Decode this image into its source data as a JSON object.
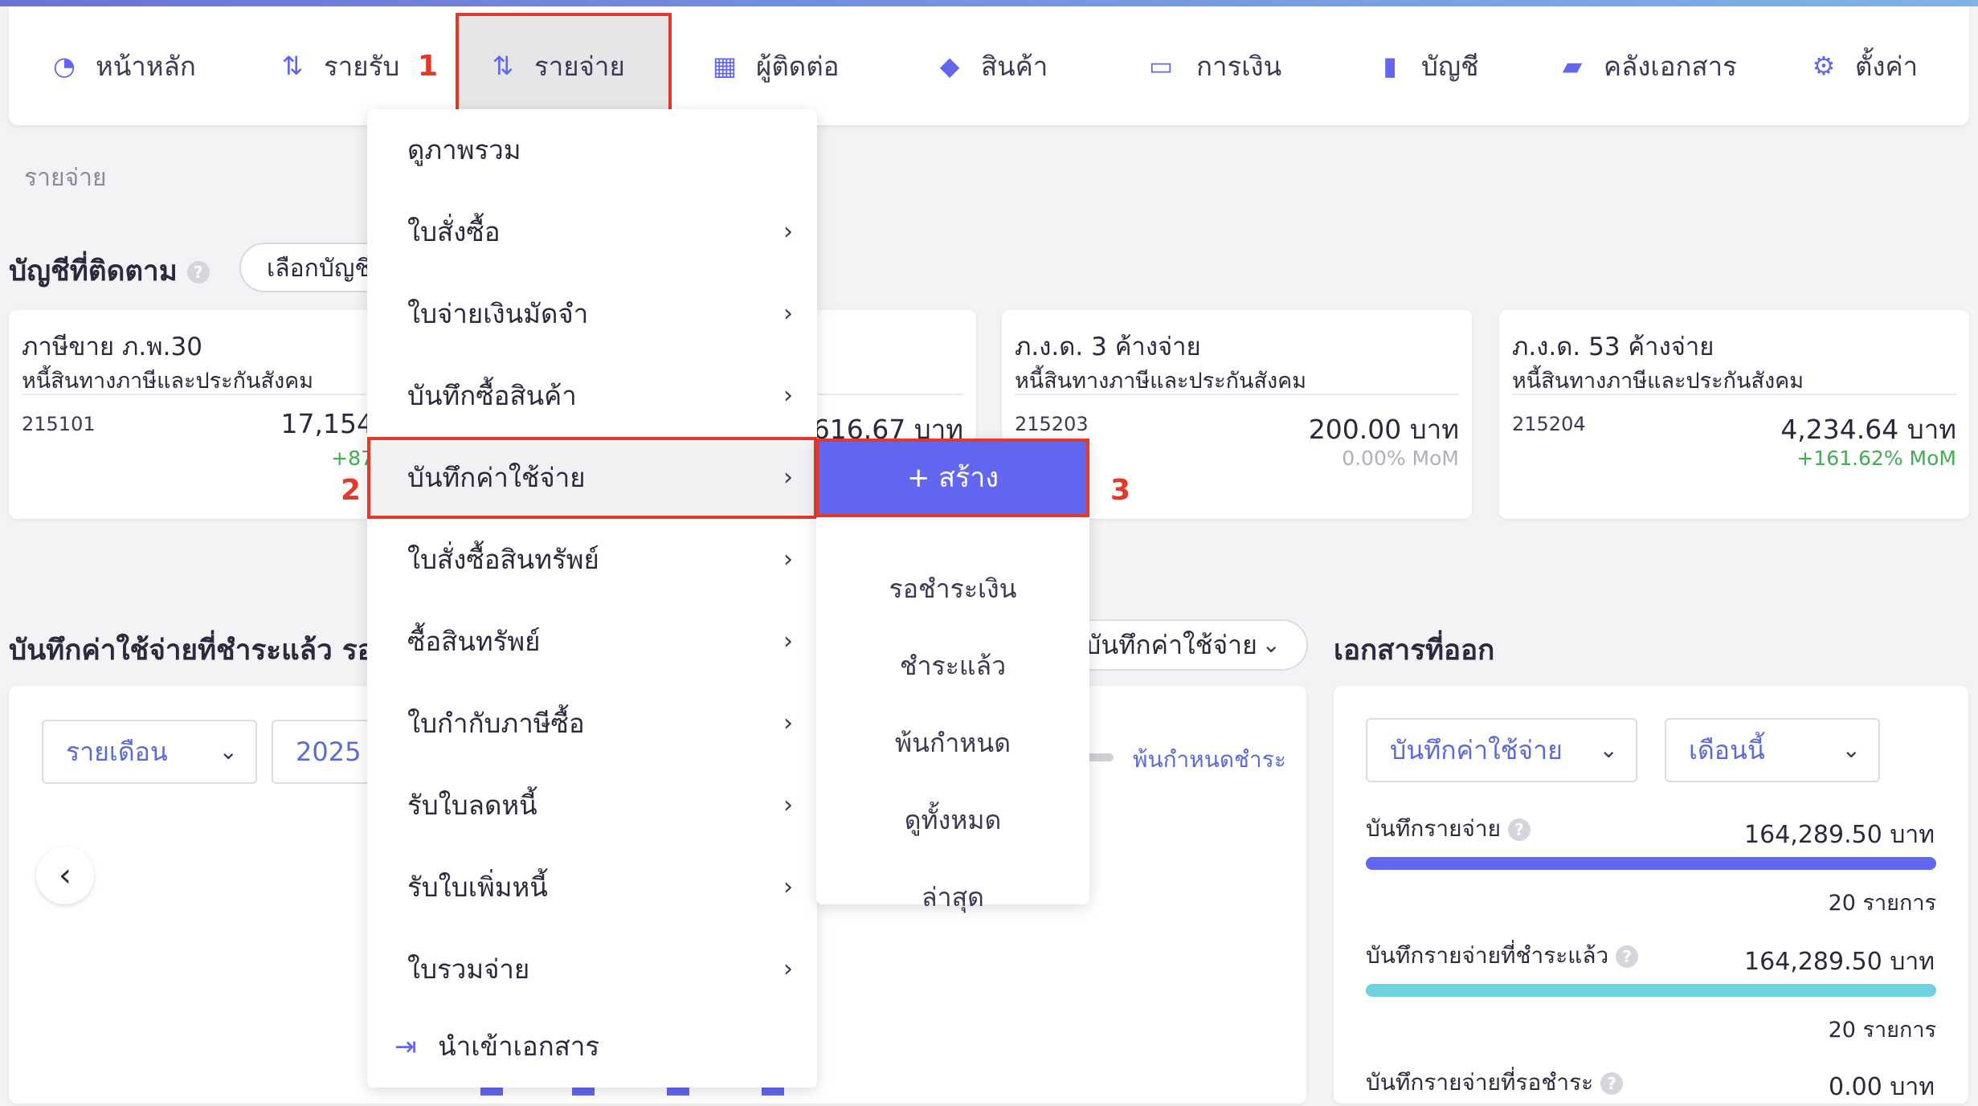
{
  "nav": {
    "items": [
      {
        "label": "หน้าหลัก",
        "icon": "chart-circle-icon"
      },
      {
        "label": "รายรับ",
        "icon": "sort-list-icon"
      },
      {
        "label": "รายจ่าย",
        "icon": "sort-list-icon"
      },
      {
        "label": "ผู้ติดต่อ",
        "icon": "building-icon"
      },
      {
        "label": "สินค้า",
        "icon": "box-icon"
      },
      {
        "label": "การเงิน",
        "icon": "money-icon"
      },
      {
        "label": "บัญชี",
        "icon": "book-icon"
      },
      {
        "label": "คลังเอกสาร",
        "icon": "folder-icon"
      },
      {
        "label": "ตั้งค่า",
        "icon": "gear-icon"
      }
    ]
  },
  "annotations": {
    "step1": "1",
    "step2": "2",
    "step3": "3"
  },
  "breadcrumb": "รายจ่าย",
  "tracked": {
    "title": "บัญชีที่ติดตาม",
    "select_label": "เลือกบัญชี",
    "cards": [
      {
        "title": "ภาษีขาย ภ.พ.30",
        "subtitle": "หนี้สินทางภาษีและประกันสังคม",
        "code": "215101",
        "amount": "17,154",
        "mom": "+87"
      },
      {
        "amount": "616.67 บาท"
      },
      {
        "title": "ภ.ง.ด. 3 ค้างจ่าย",
        "subtitle": "หนี้สินทางภาษีและประกันสังคม",
        "code": "215203",
        "amount": "200.00 บาท",
        "mom": "0.00% MoM"
      },
      {
        "title": "ภ.ง.ด. 53 ค้างจ่าย",
        "subtitle": "หนี้สินทางภาษีและประกันสังคม",
        "code": "215204",
        "amount": "4,234.64 บาท",
        "mom": "+161.62% MoM"
      }
    ]
  },
  "expense_section": {
    "title": "บันทึกค่าใช้จ่ายที่ชำระแล้ว รอชำ",
    "period_select": "รายเดือน",
    "year": "2025",
    "doc_type_select": "บันทึกค่าใช้จ่าย",
    "legend_overdue": "พ้นกำหนดชำระ"
  },
  "issued": {
    "title": "เอกสารที่ออก",
    "doc_select": "บันทึกค่าใช้จ่าย",
    "period_select": "เดือนนี้",
    "stats": [
      {
        "label": "บันทึกรายจ่าย",
        "value": "164,289.50 บาท",
        "count": "20 รายการ",
        "color": "#6366f1",
        "fill": 1.0
      },
      {
        "label": "บันทึกรายจ่ายที่ชำระแล้ว",
        "value": "164,289.50 บาท",
        "count": "20 รายการ",
        "color": "#6dd3e0",
        "fill": 1.0
      },
      {
        "label": "บันทึกรายจ่ายที่รอชำระ",
        "value": "0.00 บาท"
      }
    ]
  },
  "menu": {
    "items": [
      {
        "label": "ดูภาพรวม",
        "arrow": ""
      },
      {
        "label": "ใบสั่งซื้อ",
        "arrow": "›"
      },
      {
        "label": "ใบจ่ายเงินมัดจำ",
        "arrow": "›"
      },
      {
        "label": "บันทึกซื้อสินค้า",
        "arrow": "›"
      },
      {
        "label": "บันทึกค่าใช้จ่าย",
        "arrow": "›"
      },
      {
        "label": "ใบสั่งซื้อสินทรัพย์",
        "arrow": "›"
      },
      {
        "label": "ซื้อสินทรัพย์",
        "arrow": "›"
      },
      {
        "label": "ใบกำกับภาษีซื้อ",
        "arrow": "›"
      },
      {
        "label": "รับใบลดหนี้",
        "arrow": "›"
      },
      {
        "label": "รับใบเพิ่มหนี้",
        "arrow": "›"
      },
      {
        "label": "ใบรวมจ่าย",
        "arrow": "›"
      }
    ],
    "import_label": "นำเข้าเอกสาร"
  },
  "submenu": {
    "create": "+ สร้าง",
    "items": [
      "รอชำระเงิน",
      "ชำระแล้ว",
      "พ้นกำหนด",
      "ดูทั้งหมด",
      "ล่าสุด"
    ]
  },
  "colors": {
    "accent": "#6366f1",
    "highlight": "#e3392b",
    "positive": "#3fae55",
    "muted": "#b0b0bc"
  }
}
